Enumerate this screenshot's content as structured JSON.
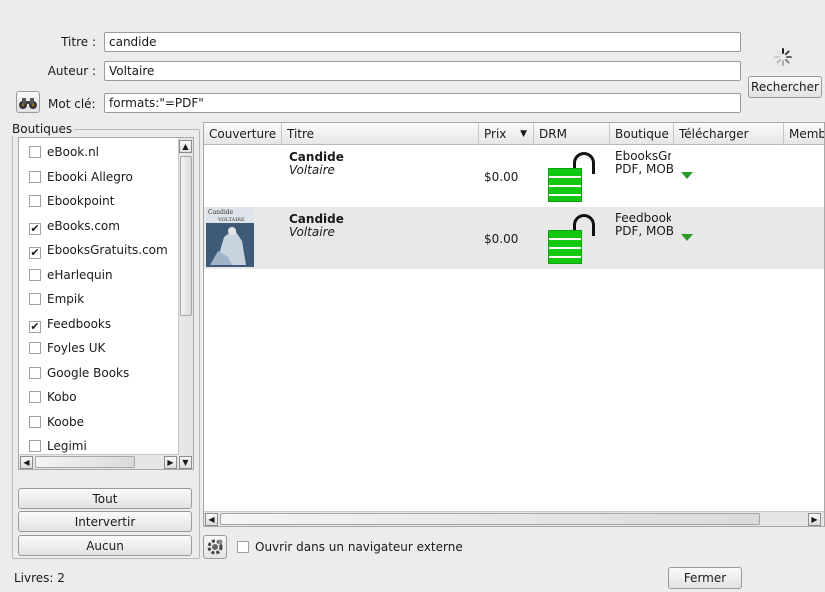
{
  "search": {
    "title_label": "Titre :",
    "title_value": "candide",
    "author_label": "Auteur :",
    "author_value": "Voltaire",
    "keyword_label": "Mot clé:",
    "keyword_value": "formats:\"=PDF\"",
    "search_button": "Rechercher"
  },
  "stores": {
    "group_label": "Boutiques",
    "items": [
      {
        "label": "eBook.nl",
        "checked": false
      },
      {
        "label": "Ebooki Allegro",
        "checked": false
      },
      {
        "label": "Ebookpoint",
        "checked": false
      },
      {
        "label": "eBooks.com",
        "checked": true
      },
      {
        "label": "EbooksGratuits.com",
        "checked": true
      },
      {
        "label": "eHarlequin",
        "checked": false
      },
      {
        "label": "Empik",
        "checked": false
      },
      {
        "label": "Feedbooks",
        "checked": true
      },
      {
        "label": "Foyles UK",
        "checked": false
      },
      {
        "label": "Google Books",
        "checked": false
      },
      {
        "label": "Kobo",
        "checked": false
      },
      {
        "label": "Koobe",
        "checked": false
      },
      {
        "label": "Legimi",
        "checked": false
      }
    ],
    "check_mark": "✔",
    "all_button": "Tout",
    "invert_button": "Intervertir",
    "none_button": "Aucun"
  },
  "results": {
    "columns": [
      "Couverture",
      "Titre",
      "Prix",
      "DRM",
      "Boutique",
      "Télécharger",
      "Memb"
    ],
    "rows": [
      {
        "title": "Candide",
        "author": "Voltaire",
        "price": "$0.00",
        "store": "EbooksGra",
        "formats": "PDF, MOBI,"
      },
      {
        "title": "Candide",
        "author": "Voltaire",
        "price": "$0.00",
        "store": "Feedbooks",
        "formats": "PDF, MOBI,"
      }
    ],
    "cover_text_line1": "Candide",
    "cover_text_line2": "VOLTAIRE"
  },
  "options": {
    "open_external": "Ouvrir dans un navigateur externe",
    "open_external_checked": false
  },
  "status": {
    "books_count": "Livres: 2"
  },
  "close_button": "Fermer",
  "icons": {
    "binoculars": "binoculars-icon",
    "spinner": "loading-spinner-icon",
    "config": "config-gear-icon",
    "lock": "unlocked-drm-icon",
    "download": "download-arrow-icon"
  },
  "colors": {
    "drm_green": "#10c810",
    "download_green": "#2a9a2a",
    "row_alt": "#e8e8e8"
  }
}
